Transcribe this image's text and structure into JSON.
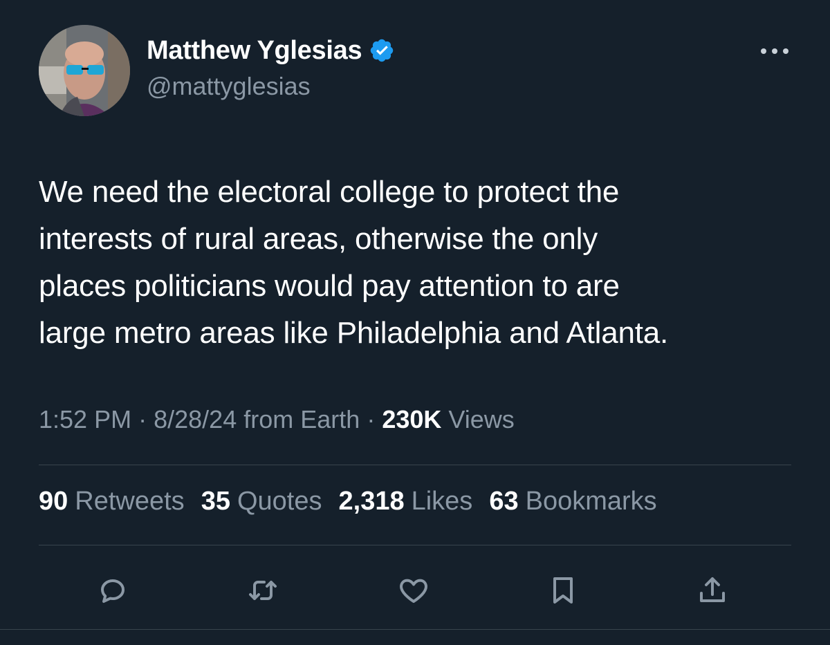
{
  "author": {
    "display_name": "Matthew Yglesias",
    "handle": "@mattyglesias",
    "verified": true,
    "verified_color": "#1d9bf0"
  },
  "tweet": {
    "text": "We need the electoral college to protect the\ninterests of rural areas, otherwise the only\nplaces politicians would pay attention to are\nlarge metro areas like Philadelphia and Atlanta."
  },
  "meta": {
    "time": "1:52 PM",
    "sep1": "·",
    "date": "8/28/24",
    "source": "from Earth",
    "sep2": "·",
    "views_count": "230K",
    "views_label": "Views"
  },
  "stats": {
    "retweets_count": "90",
    "retweets_label": "Retweets",
    "quotes_count": "35",
    "quotes_label": "Quotes",
    "likes_count": "2,318",
    "likes_label": "Likes",
    "bookmarks_count": "63",
    "bookmarks_label": "Bookmarks"
  },
  "icons": {
    "more": "more-horizontal-icon",
    "reply": "reply-icon",
    "retweet": "retweet-icon",
    "like": "heart-icon",
    "bookmark": "bookmark-icon",
    "share": "share-icon"
  },
  "colors": {
    "background": "#15202b",
    "secondary_text": "#8b98a5",
    "divider": "#38444d",
    "icon": "#8b98a5"
  }
}
